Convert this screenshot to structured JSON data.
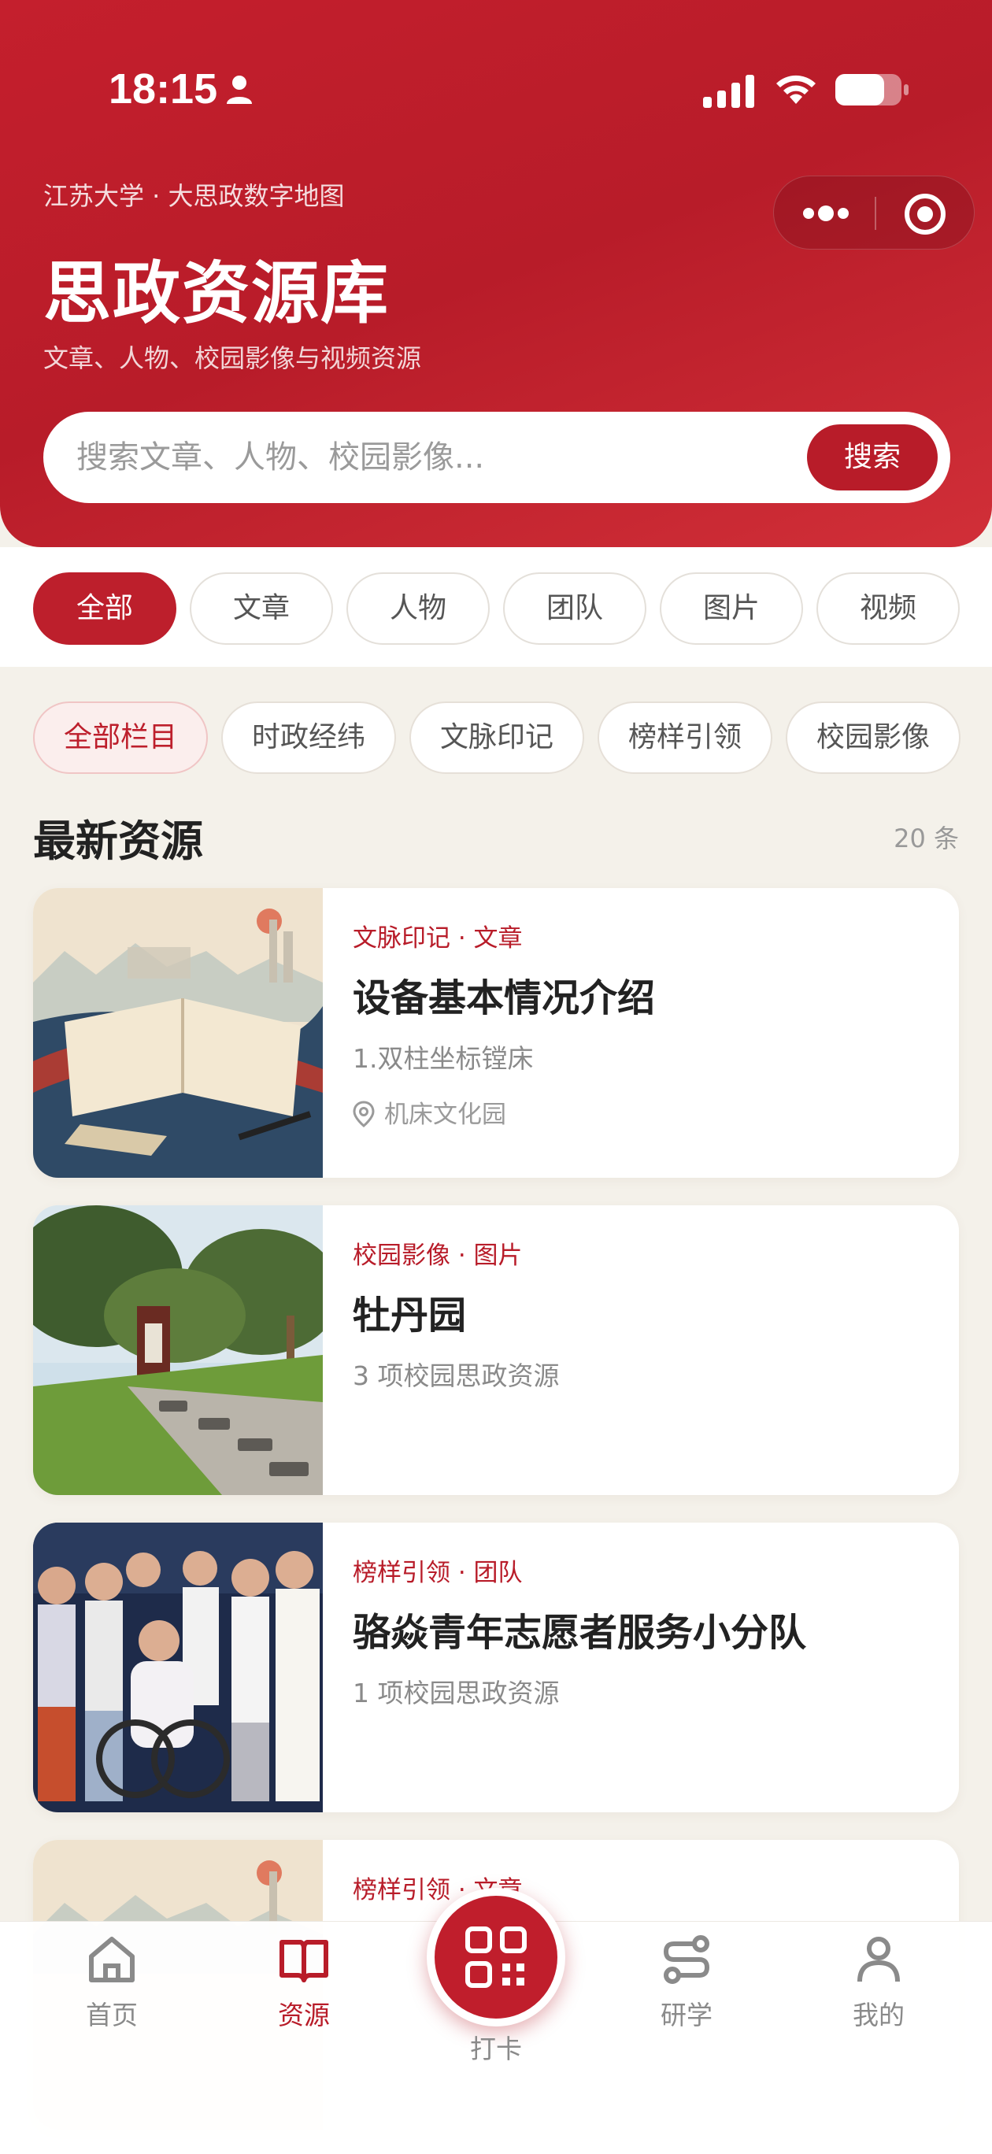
{
  "status_bar": {
    "time": "18:15"
  },
  "header": {
    "subtitle": "江苏大学 · 大思政数字地图",
    "title": "思政资源库",
    "description": "文章、人物、校园影像与视频资源"
  },
  "search": {
    "placeholder": "搜索文章、人物、校园影像...",
    "button_label": "搜索"
  },
  "type_filters": [
    {
      "label": "全部",
      "active": true
    },
    {
      "label": "文章"
    },
    {
      "label": "人物"
    },
    {
      "label": "团队"
    },
    {
      "label": "图片"
    },
    {
      "label": "视频"
    }
  ],
  "column_filters": [
    {
      "label": "全部栏目",
      "active": true
    },
    {
      "label": "时政经纬"
    },
    {
      "label": "文脉印记"
    },
    {
      "label": "榜样引领"
    },
    {
      "label": "校园影像"
    }
  ],
  "section": {
    "title": "最新资源",
    "count": "20 条"
  },
  "cards": [
    {
      "category": "文脉印记 · 文章",
      "title": "设备基本情况介绍",
      "desc": "1.双柱坐标镗床",
      "location": "机床文化园"
    },
    {
      "category": "校园影像 · 图片",
      "title": "牡丹园",
      "desc": "3 项校园思政资源"
    },
    {
      "category": "榜样引领 · 团队",
      "title": "骆焱青年志愿者服务小分队",
      "desc": "1 项校园思政资源"
    },
    {
      "category": "榜样引领 · 文章"
    }
  ],
  "bottom_nav": {
    "home": "首页",
    "resources": "资源",
    "checkin": "打卡",
    "study": "研学",
    "mine": "我的"
  },
  "colors": {
    "primary": "#bd1f2c",
    "background": "#f4f1ea"
  }
}
